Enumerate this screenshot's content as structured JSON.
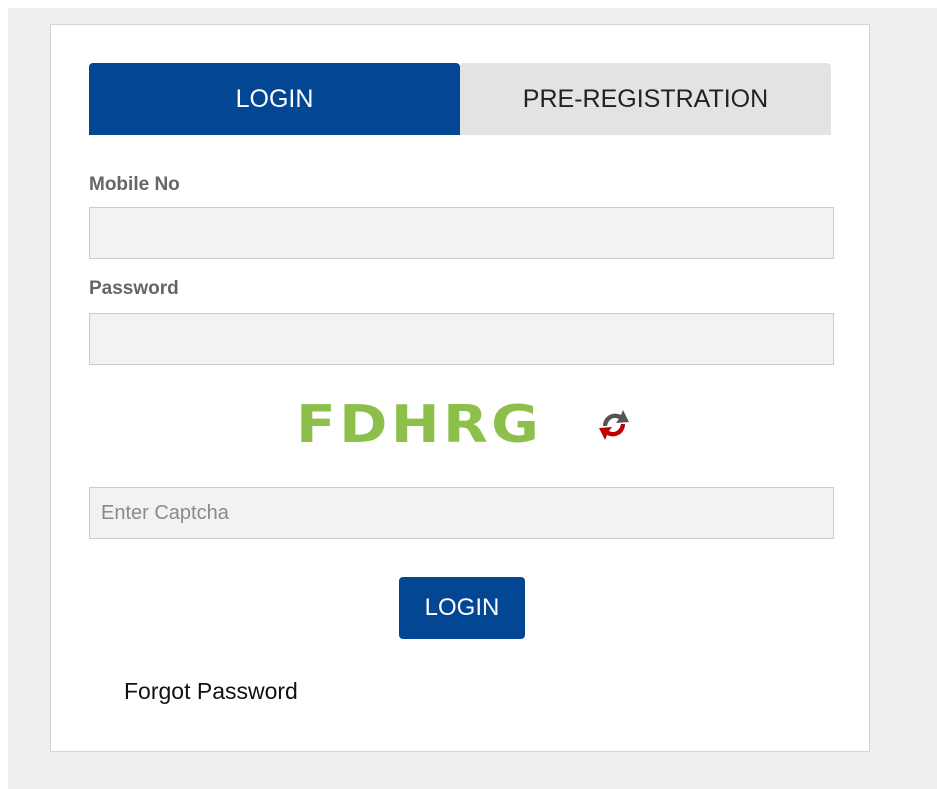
{
  "tabs": {
    "login": "LOGIN",
    "pre_registration": "PRE-REGISTRATION"
  },
  "form": {
    "mobile_label": "Mobile No",
    "mobile_value": "",
    "password_label": "Password",
    "password_value": "",
    "captcha_text": "FDHRG",
    "captcha_placeholder": "Enter Captcha",
    "captcha_value": "",
    "login_button": "LOGIN",
    "forgot_password": "Forgot Password"
  },
  "colors": {
    "primary": "#034694",
    "captcha": "#8cc04b",
    "refresh_icon_red": "#c00000",
    "refresh_icon_gray": "#555555"
  },
  "icons": {
    "refresh": "refresh-captcha-icon"
  }
}
